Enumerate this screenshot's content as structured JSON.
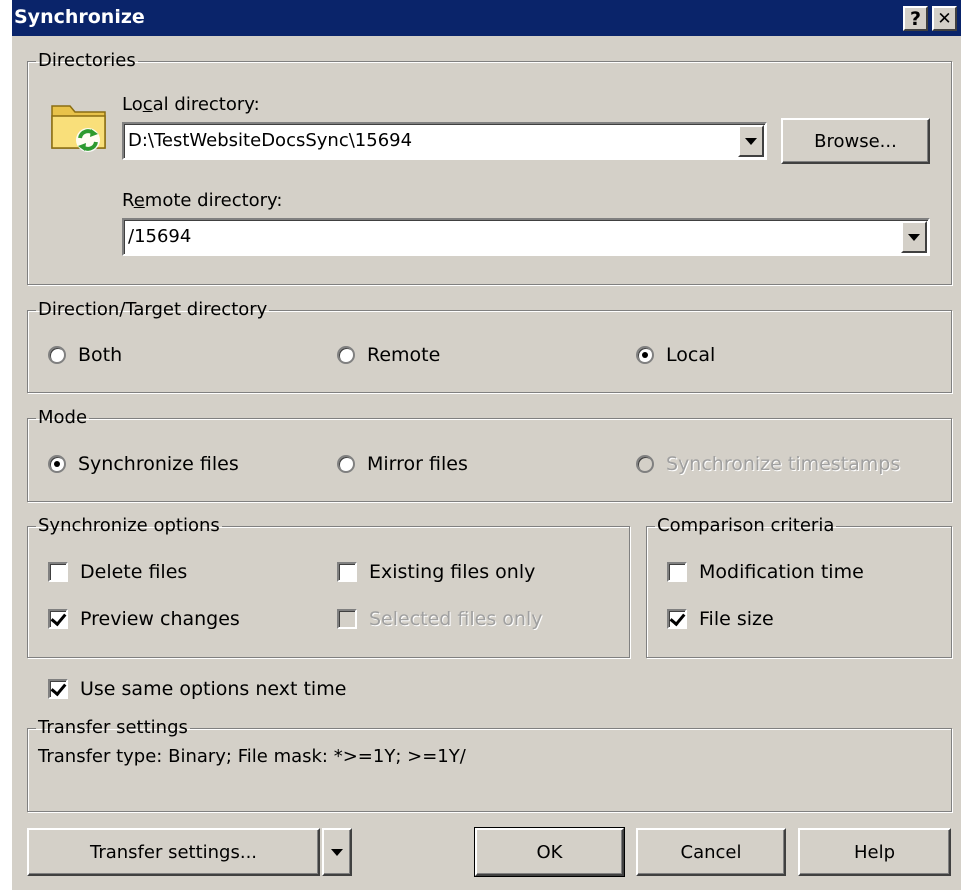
{
  "window": {
    "title": "Synchronize",
    "help_glyph": "?",
    "close_glyph": "✕"
  },
  "directories": {
    "legend": "Directories",
    "local_label_pre": "Lo",
    "local_label_acc": "c",
    "local_label_post": "al directory:",
    "local_value": "D:\\TestWebsiteDocsSync\\15694",
    "browse_label": "Browse...",
    "remote_label_pre": "R",
    "remote_label_acc": "e",
    "remote_label_post": "mote directory:",
    "remote_value": "/15694"
  },
  "direction": {
    "legend": "Direction/Target directory",
    "both": "Both",
    "remote": "Remote",
    "local": "Local",
    "selected": "Local"
  },
  "mode": {
    "legend": "Mode",
    "synchronize_files": "Synchronize files",
    "mirror_files": "Mirror files",
    "synchronize_timestamps": "Synchronize timestamps",
    "selected": "Synchronize files"
  },
  "sync_options": {
    "legend": "Synchronize options",
    "delete_files": "Delete files",
    "existing_files_only": "Existing files only",
    "preview_changes": "Preview changes",
    "selected_files_only": "Selected files only"
  },
  "comparison": {
    "legend": "Comparison criteria",
    "modification_time": "Modification time",
    "file_size": "File size"
  },
  "use_same_options": "Use same options next time",
  "transfer": {
    "legend": "Transfer settings",
    "summary": "Transfer type: Binary; File mask: *>=1Y; >=1Y/"
  },
  "buttons": {
    "transfer_settings": "Transfer settings...",
    "ok": "OK",
    "cancel": "Cancel",
    "help": "Help"
  },
  "colors": {
    "titlebar": "#0a246a",
    "face": "#d4d0c8",
    "folder": "#f5d76e",
    "sync_arrows": "#2e9a2e"
  },
  "icons": {
    "folder": "folder-sync-icon"
  }
}
